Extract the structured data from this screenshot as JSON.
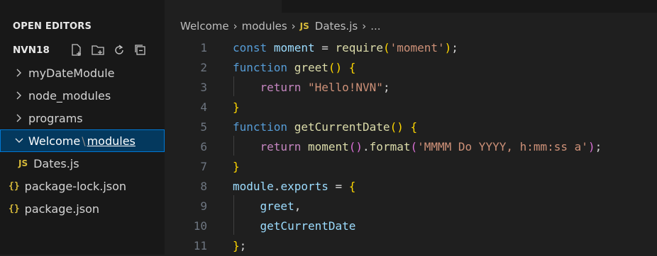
{
  "sidebar": {
    "section_title": "OPEN EDITORS",
    "folder_name": "NVN18",
    "items": [
      {
        "label": "myDateModule",
        "kind": "folder"
      },
      {
        "label": "node_modules",
        "kind": "folder"
      },
      {
        "label": "programs",
        "kind": "folder"
      },
      {
        "label_parent": "Welcome",
        "label_sep": "\\",
        "label_child": "modules",
        "kind": "folder-open"
      },
      {
        "label": "Dates.js",
        "badge": "JS",
        "kind": "file"
      },
      {
        "label": "package-lock.json",
        "badge": "{}",
        "kind": "file"
      },
      {
        "label": "package.json",
        "badge": "{}",
        "kind": "file"
      }
    ]
  },
  "breadcrumb": {
    "parts": [
      "Welcome",
      "modules",
      "Dates.js",
      "..."
    ],
    "file_badge": "JS"
  },
  "editor": {
    "line_numbers": [
      "1",
      "2",
      "3",
      "4",
      "5",
      "6",
      "7",
      "8",
      "9",
      "10",
      "11"
    ],
    "lines": [
      [
        {
          "t": "const",
          "c": "kw"
        },
        {
          "t": " ",
          "c": "op"
        },
        {
          "t": "moment",
          "c": "var"
        },
        {
          "t": " = ",
          "c": "op"
        },
        {
          "t": "require",
          "c": "fn"
        },
        {
          "t": "(",
          "c": "b1"
        },
        {
          "t": "'moment'",
          "c": "str"
        },
        {
          "t": ")",
          "c": "b1"
        },
        {
          "t": ";",
          "c": "op"
        }
      ],
      [
        {
          "t": "function",
          "c": "kw"
        },
        {
          "t": " ",
          "c": "op"
        },
        {
          "t": "greet",
          "c": "fn"
        },
        {
          "t": "()",
          "c": "b1"
        },
        {
          "t": " ",
          "c": "op"
        },
        {
          "t": "{",
          "c": "b1"
        }
      ],
      [
        {
          "t": "    ",
          "c": "op"
        },
        {
          "t": "return",
          "c": "ctl"
        },
        {
          "t": " ",
          "c": "op"
        },
        {
          "t": "\"Hello!NVN\"",
          "c": "str"
        },
        {
          "t": ";",
          "c": "op"
        }
      ],
      [
        {
          "t": "}",
          "c": "b1"
        }
      ],
      [
        {
          "t": "function",
          "c": "kw"
        },
        {
          "t": " ",
          "c": "op"
        },
        {
          "t": "getCurrentDate",
          "c": "fn"
        },
        {
          "t": "()",
          "c": "b1"
        },
        {
          "t": " ",
          "c": "op"
        },
        {
          "t": "{",
          "c": "b1"
        }
      ],
      [
        {
          "t": "    ",
          "c": "op"
        },
        {
          "t": "return",
          "c": "ctl"
        },
        {
          "t": " ",
          "c": "op"
        },
        {
          "t": "moment",
          "c": "fn"
        },
        {
          "t": "()",
          "c": "b2"
        },
        {
          "t": ".",
          "c": "op"
        },
        {
          "t": "format",
          "c": "fn"
        },
        {
          "t": "(",
          "c": "b2"
        },
        {
          "t": "'MMMM Do YYYY, h:mm:ss a'",
          "c": "str"
        },
        {
          "t": ")",
          "c": "b2"
        },
        {
          "t": ";",
          "c": "op"
        }
      ],
      [
        {
          "t": "}",
          "c": "b1"
        }
      ],
      [
        {
          "t": "module",
          "c": "var"
        },
        {
          "t": ".",
          "c": "op"
        },
        {
          "t": "exports",
          "c": "var"
        },
        {
          "t": " = ",
          "c": "op"
        },
        {
          "t": "{",
          "c": "b1"
        }
      ],
      [
        {
          "t": "    ",
          "c": "op"
        },
        {
          "t": "greet",
          "c": "var"
        },
        {
          "t": ",",
          "c": "op"
        }
      ],
      [
        {
          "t": "    ",
          "c": "op"
        },
        {
          "t": "getCurrentDate",
          "c": "var"
        }
      ],
      [
        {
          "t": "}",
          "c": "b1"
        },
        {
          "t": ";",
          "c": "op"
        }
      ]
    ]
  },
  "icons": [
    "new-file-icon",
    "new-folder-icon",
    "refresh-icon",
    "collapse-all-icon",
    "chevron-right-icon",
    "chevron-down-icon"
  ]
}
